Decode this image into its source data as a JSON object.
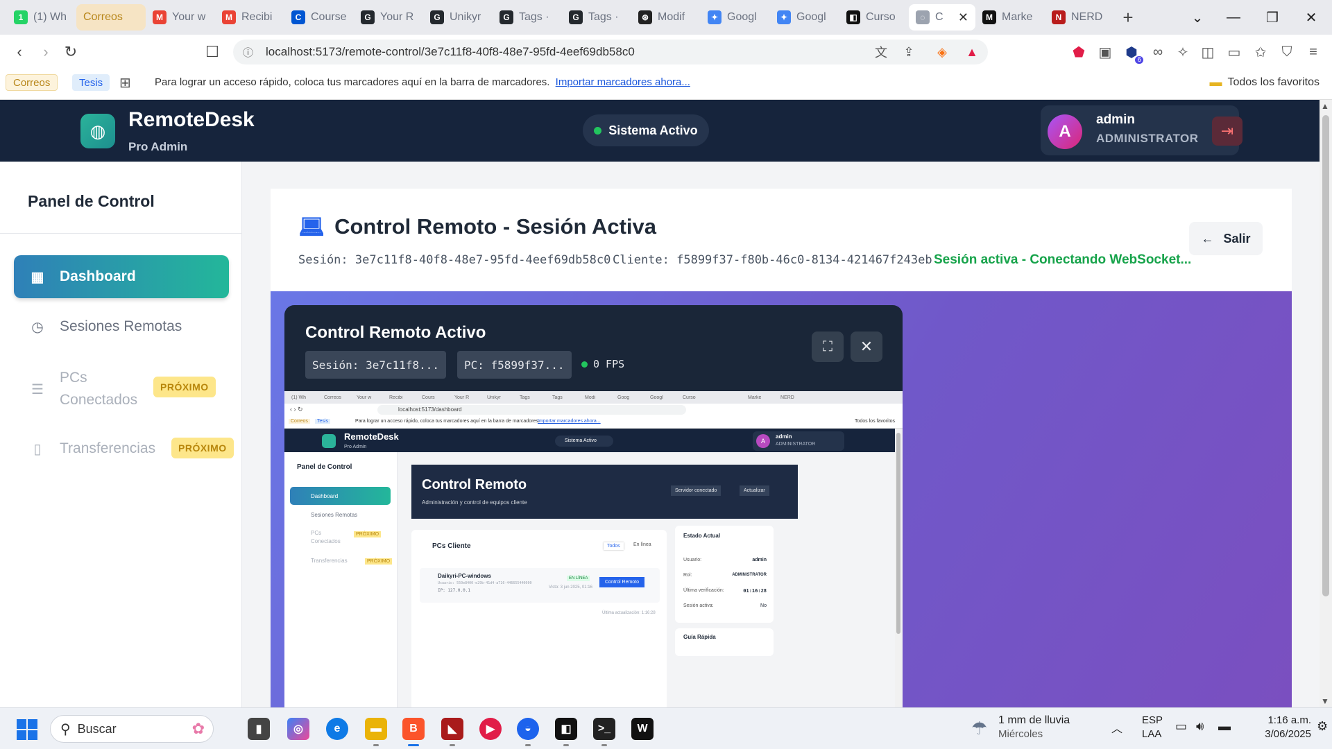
{
  "browser": {
    "tabs": [
      {
        "label": "(1) Wh",
        "icon": "whatsapp-icon",
        "color": "#25d366",
        "glyph": "1"
      },
      {
        "label": "Correos",
        "icon": "folder-icon",
        "color": "#d9a520",
        "glyph": ""
      },
      {
        "label": "Your w",
        "icon": "gmail-icon",
        "color": "#ea4335",
        "glyph": "M"
      },
      {
        "label": "Recibi",
        "icon": "gmail-icon",
        "color": "#ea4335",
        "glyph": "M"
      },
      {
        "label": "Course",
        "icon": "coursera-icon",
        "color": "#0056d2",
        "glyph": "C"
      },
      {
        "label": "Your R",
        "icon": "github-icon",
        "color": "#24292e",
        "glyph": "G"
      },
      {
        "label": "Unikyr",
        "icon": "github-icon",
        "color": "#24292e",
        "glyph": "G"
      },
      {
        "label": "Tags ·",
        "icon": "github-icon",
        "color": "#24292e",
        "glyph": "G"
      },
      {
        "label": "Tags ·",
        "icon": "github-icon",
        "color": "#24292e",
        "glyph": "G"
      },
      {
        "label": "Modif",
        "icon": "openai-icon",
        "color": "#222222",
        "glyph": "⊛"
      },
      {
        "label": "Googl",
        "icon": "gemini-icon",
        "color": "#4285f4",
        "glyph": "✦"
      },
      {
        "label": "Googl",
        "icon": "gemini-icon",
        "color": "#4285f4",
        "glyph": "✦"
      },
      {
        "label": "Curso",
        "icon": "cursor-icon",
        "color": "#111111",
        "glyph": "◧"
      },
      {
        "label": "C",
        "icon": "loading-icon",
        "color": "#9ca3af",
        "glyph": "◌",
        "active": true
      },
      {
        "label": "Marke",
        "icon": "medium-icon",
        "color": "#111111",
        "glyph": "M"
      },
      {
        "label": "NERD",
        "icon": "nerd-icon",
        "color": "#b91c1c",
        "glyph": "N"
      }
    ],
    "url": "localhost:5173/remote-control/3e7c11f8-40f8-48e7-95fd-4eef69db58c0",
    "bookmarks": {
      "chips": [
        "Correos",
        "Tesis"
      ],
      "message": "Para lograr un acceso rápido, coloca tus marcadores aquí en la barra de marcadores.",
      "import_link": "Importar marcadores ahora...",
      "all_favorites": "Todos los favoritos"
    },
    "extension_badge": "6"
  },
  "header": {
    "app_name": "RemoteDesk",
    "app_sub": "Pro Admin",
    "status": "Sistema Activo",
    "user": {
      "initial": "A",
      "name": "admin",
      "role": "ADMINISTRATOR"
    }
  },
  "sidebar": {
    "title": "Panel de Control",
    "items": [
      {
        "label": "Dashboard",
        "icon": "dashboard-icon"
      },
      {
        "label": "Sesiones Remotas",
        "icon": "clock-icon"
      },
      {
        "label_line1": "PCs",
        "label_line2": "Conectados",
        "badge": "PRÓXIMO",
        "icon": "document-icon"
      },
      {
        "label": "Transferencias",
        "badge": "PRÓXIMO",
        "icon": "file-icon"
      }
    ]
  },
  "session": {
    "title": "Control Remoto - Sesión Activa",
    "session_id": "Sesión: 3e7c11f8-40f8-48e7-95fd-4eef69db58c0",
    "client_id": "Cliente: f5899f37-f80b-46c0-8134-421467f243eb",
    "status": "Sesión activa - Conectando WebSocket...",
    "exit_label": "Salir"
  },
  "remote_panel": {
    "title": "Control Remoto Activo",
    "session_chip": "Sesión: 3e7c11f8...",
    "pc_chip": "PC: f5899f37...",
    "fps": "0 FPS"
  },
  "remote_screen": {
    "tabs": [
      "(1) Wh",
      "Correos",
      "Your w",
      "Recibi",
      "Cours",
      "Your R",
      "Unikyr",
      "Tags",
      "Tags",
      "Modi",
      "Goog",
      "Googl",
      "Curso",
      "",
      "Marke",
      "NERD"
    ],
    "url": "localhost:5173/dashboard",
    "bm_chips": [
      "Correos",
      "Tesis"
    ],
    "bm_message": "Para lograr un acceso rápido, coloca tus marcadores aquí en la barra de marcadores.",
    "bm_link": "Importar marcadores ahora...",
    "bm_fav": "Todos los favoritos",
    "app_name": "RemoteDesk",
    "app_sub": "Pro Admin",
    "status": "Sistema Activo",
    "user_initial": "A",
    "user_name": "admin",
    "user_role": "ADMINISTRATOR",
    "side_title": "Panel de Control",
    "side_items": [
      "Dashboard",
      "Sesiones Remotas",
      "PCs",
      "Conectados",
      "Transferencias"
    ],
    "side_badge": "PRÓXIMO",
    "banner_title": "Control Remoto",
    "banner_sub": "Administración y control de equipos cliente",
    "server_btn": "Servidor conectado",
    "refresh_btn": "Actualizar",
    "pcs_title": "PCs Cliente",
    "filter_all": "Todos",
    "filter_online": "En línea",
    "pc_name": "Daikyri-PC-windows",
    "pc_user": "Usuario: 550e8400-e29b-41d4-a716-446655440000",
    "pc_ip": "IP: 127.0.0.1",
    "pc_status": "EN LÍNEA",
    "pc_seen": "Visto: 3 jun 2025, 01:16",
    "pc_btn": "Control Remoto",
    "last_update": "Última actualización: 1:16:28",
    "state_title": "Estado Actual",
    "state_rows": [
      {
        "k": "Usuario:",
        "v": "admin"
      },
      {
        "k": "Rol:",
        "v": "ADMINISTRATOR"
      },
      {
        "k": "Última verificación:",
        "v": "01:16:28"
      },
      {
        "k": "Sesión activa:",
        "v": "No"
      }
    ],
    "guide_title": "Guía Rápida"
  },
  "taskbar": {
    "search_placeholder": "Buscar",
    "weather": "1 mm de lluvia",
    "weather_day": "Miércoles",
    "lang1": "ESP",
    "lang2": "LAA",
    "time": "1:16 a.m.",
    "date": "3/06/2025"
  },
  "colors": {
    "header_bg": "#16243c",
    "accent_green": "#16a34a",
    "active_gradient_start": "#2f80b8",
    "active_gradient_end": "#23b79a",
    "badge_bg": "#fde68a",
    "purple_bg": "#7058c9"
  }
}
